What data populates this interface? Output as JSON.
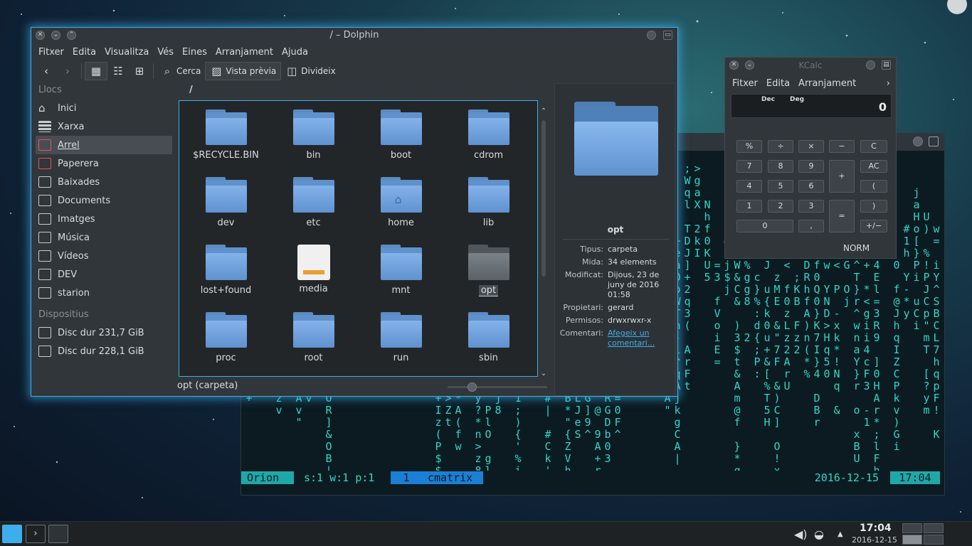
{
  "dolphin": {
    "title": "/ – Dolphin",
    "menu": [
      "Fitxer",
      "Edita",
      "Visualitza",
      "Vés",
      "Eines",
      "Arranjament",
      "Ajuda"
    ],
    "toolbar": {
      "search": "Cerca",
      "preview": "Vista prèvia",
      "split": "Divideix"
    },
    "places_header": "Llocs",
    "places": [
      "Inici",
      "Xarxa",
      "Arrel",
      "Paperera",
      "Baixades",
      "Documents",
      "Imatges",
      "Música",
      "Vídeos",
      "DEV",
      "starion"
    ],
    "devices_header": "Dispositius",
    "devices": [
      "Disc dur 231,7 GiB",
      "Disc dur 228,1 GiB"
    ],
    "path": "/",
    "items": [
      "$RECYCLE.BIN",
      "bin",
      "boot",
      "cdrom",
      "dev",
      "etc",
      "home",
      "lib",
      "lost+found",
      "media",
      "mnt",
      "opt",
      "proc",
      "root",
      "run",
      "sbin"
    ],
    "status": "opt (carpeta)",
    "info": {
      "name": "opt",
      "labels": {
        "type": "Tipus:",
        "size": "Mida:",
        "modified": "Modificat:",
        "owner": "Propietari:",
        "perms": "Permisos:",
        "comment": "Comentari:"
      },
      "type": "carpeta",
      "size": "34 elements",
      "modified": "Dijous, 23 de juny de 2016 01:58",
      "owner": "gerard",
      "perms": "drwxrwxr-x",
      "comment": "Afegeix un comentari..."
    }
  },
  "kcalc": {
    "title": "KCalc",
    "menu": [
      "Fitxer",
      "Edita",
      "Arranjament"
    ],
    "menu_more": "›",
    "display_base": "Dec",
    "display_angle": "Deg",
    "display_value": "0",
    "keys": {
      "pct": "%",
      "div": "÷",
      "mul": "×",
      "minus": "−",
      "clear": "C",
      "k7": "7",
      "k8": "8",
      "k9": "9",
      "plus": "+",
      "ac": "AC",
      "k4": "4",
      "k5": "5",
      "k6": "6",
      "lparen": "(",
      "k1": "1",
      "k2": "2",
      "k3": "3",
      "eq": "=",
      "rparen": ")",
      "k0": "0",
      "dot": ",",
      "neg": "+/−"
    },
    "mode": "NORM"
  },
  "terminal": {
    "session": "Orion",
    "stats": "s:1 w:1 p:1",
    "window_index": "1",
    "window_name": "cmatrix",
    "date": "2016-12-15",
    "time": "17:04"
  },
  "taskbar": {
    "time": "17:04",
    "date": "2016-12-15"
  },
  "colors": {
    "accent": "#3daee9",
    "matrix": "#2fd6c6",
    "status_teal": "#1fa8a8",
    "status_blue": "#1b7fd6"
  }
}
